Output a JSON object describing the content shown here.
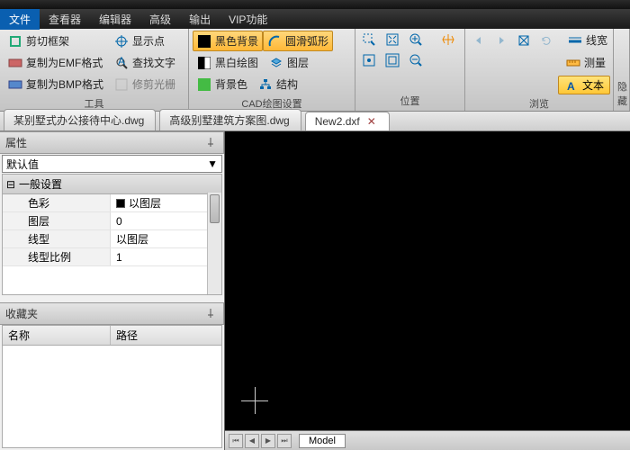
{
  "menu": {
    "file": "文件",
    "viewer": "查看器",
    "editor": "编辑器",
    "advanced": "高级",
    "output": "输出",
    "vip": "VIP功能"
  },
  "ribbon": {
    "tools": {
      "caption": "工具",
      "crop": "剪切框架",
      "copy_emf": "复制为EMF格式",
      "copy_bmp": "复制为BMP格式",
      "showpoint": "显示点",
      "findtext": "查找文字",
      "trimray": "修剪光栅"
    },
    "cad": {
      "caption": "CAD绘图设置",
      "blackbg": "黑色背景",
      "smootharc": "圆滑弧形",
      "bwdraw": "黑白绘图",
      "layer": "图层",
      "bgcolor": "背景色",
      "struct": "结构"
    },
    "pos": {
      "caption": "位置"
    },
    "browse": {
      "caption": "浏览",
      "linew": "线宽",
      "measure": "测量",
      "text": "文本"
    },
    "hide": {
      "caption": "隐藏"
    }
  },
  "tabs": {
    "t1": "某别墅式办公接待中心.dwg",
    "t2": "高级别墅建筑方案图.dwg",
    "t3": "New2.dxf"
  },
  "props": {
    "title": "属性",
    "default": "默认值",
    "general": "一般设置",
    "color": {
      "label": "色彩",
      "value": "以图层"
    },
    "layer": {
      "label": "图层",
      "value": "0"
    },
    "linetype": {
      "label": "线型",
      "value": "以图层"
    },
    "ltscale": {
      "label": "线型比例",
      "value": "1"
    }
  },
  "fav": {
    "title": "收藏夹",
    "col1": "名称",
    "col2": "路径"
  },
  "model": "Model"
}
